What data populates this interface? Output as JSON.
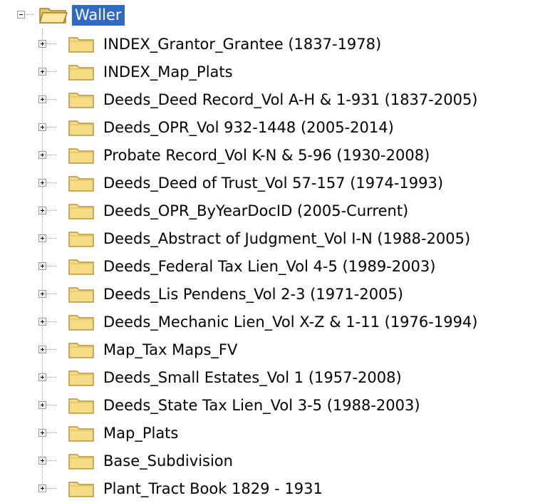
{
  "tree": {
    "root": {
      "label": "Waller",
      "expanded": true,
      "selected": true
    },
    "children": [
      {
        "label": "INDEX_Grantor_Grantee (1837-1978)"
      },
      {
        "label": "INDEX_Map_Plats"
      },
      {
        "label": "Deeds_Deed Record_Vol A-H & 1-931 (1837-2005)"
      },
      {
        "label": "Deeds_OPR_Vol 932-1448 (2005-2014)"
      },
      {
        "label": "Probate Record_Vol K-N & 5-96 (1930-2008)"
      },
      {
        "label": "Deeds_Deed of Trust_Vol 57-157 (1974-1993)"
      },
      {
        "label": "Deeds_OPR_ByYearDocID (2005-Current)"
      },
      {
        "label": "Deeds_Abstract of Judgment_Vol I-N (1988-2005)"
      },
      {
        "label": "Deeds_Federal Tax Lien_Vol 4-5 (1989-2003)"
      },
      {
        "label": "Deeds_Lis Pendens_Vol 2-3 (1971-2005)"
      },
      {
        "label": "Deeds_Mechanic Lien_Vol X-Z & 1-11 (1976-1994)"
      },
      {
        "label": "Map_Tax Maps_FV"
      },
      {
        "label": "Deeds_Small Estates_Vol 1 (1957-2008)"
      },
      {
        "label": "Deeds_State Tax Lien_Vol 3-5 (1988-2003)"
      },
      {
        "label": "Map_Plats"
      },
      {
        "label": "Base_Subdivision"
      },
      {
        "label": "Plant_Tract Book 1829 - 1931"
      }
    ]
  },
  "colors": {
    "selection_bg": "#316ac5",
    "selection_text": "#ffffff",
    "folder_fill": "#f6dc84",
    "folder_edge": "#b9923a"
  },
  "icons": {
    "root": "open-folder-icon",
    "child": "closed-folder-icon",
    "root_expander": "collapse-icon",
    "child_expander": "expand-icon"
  }
}
